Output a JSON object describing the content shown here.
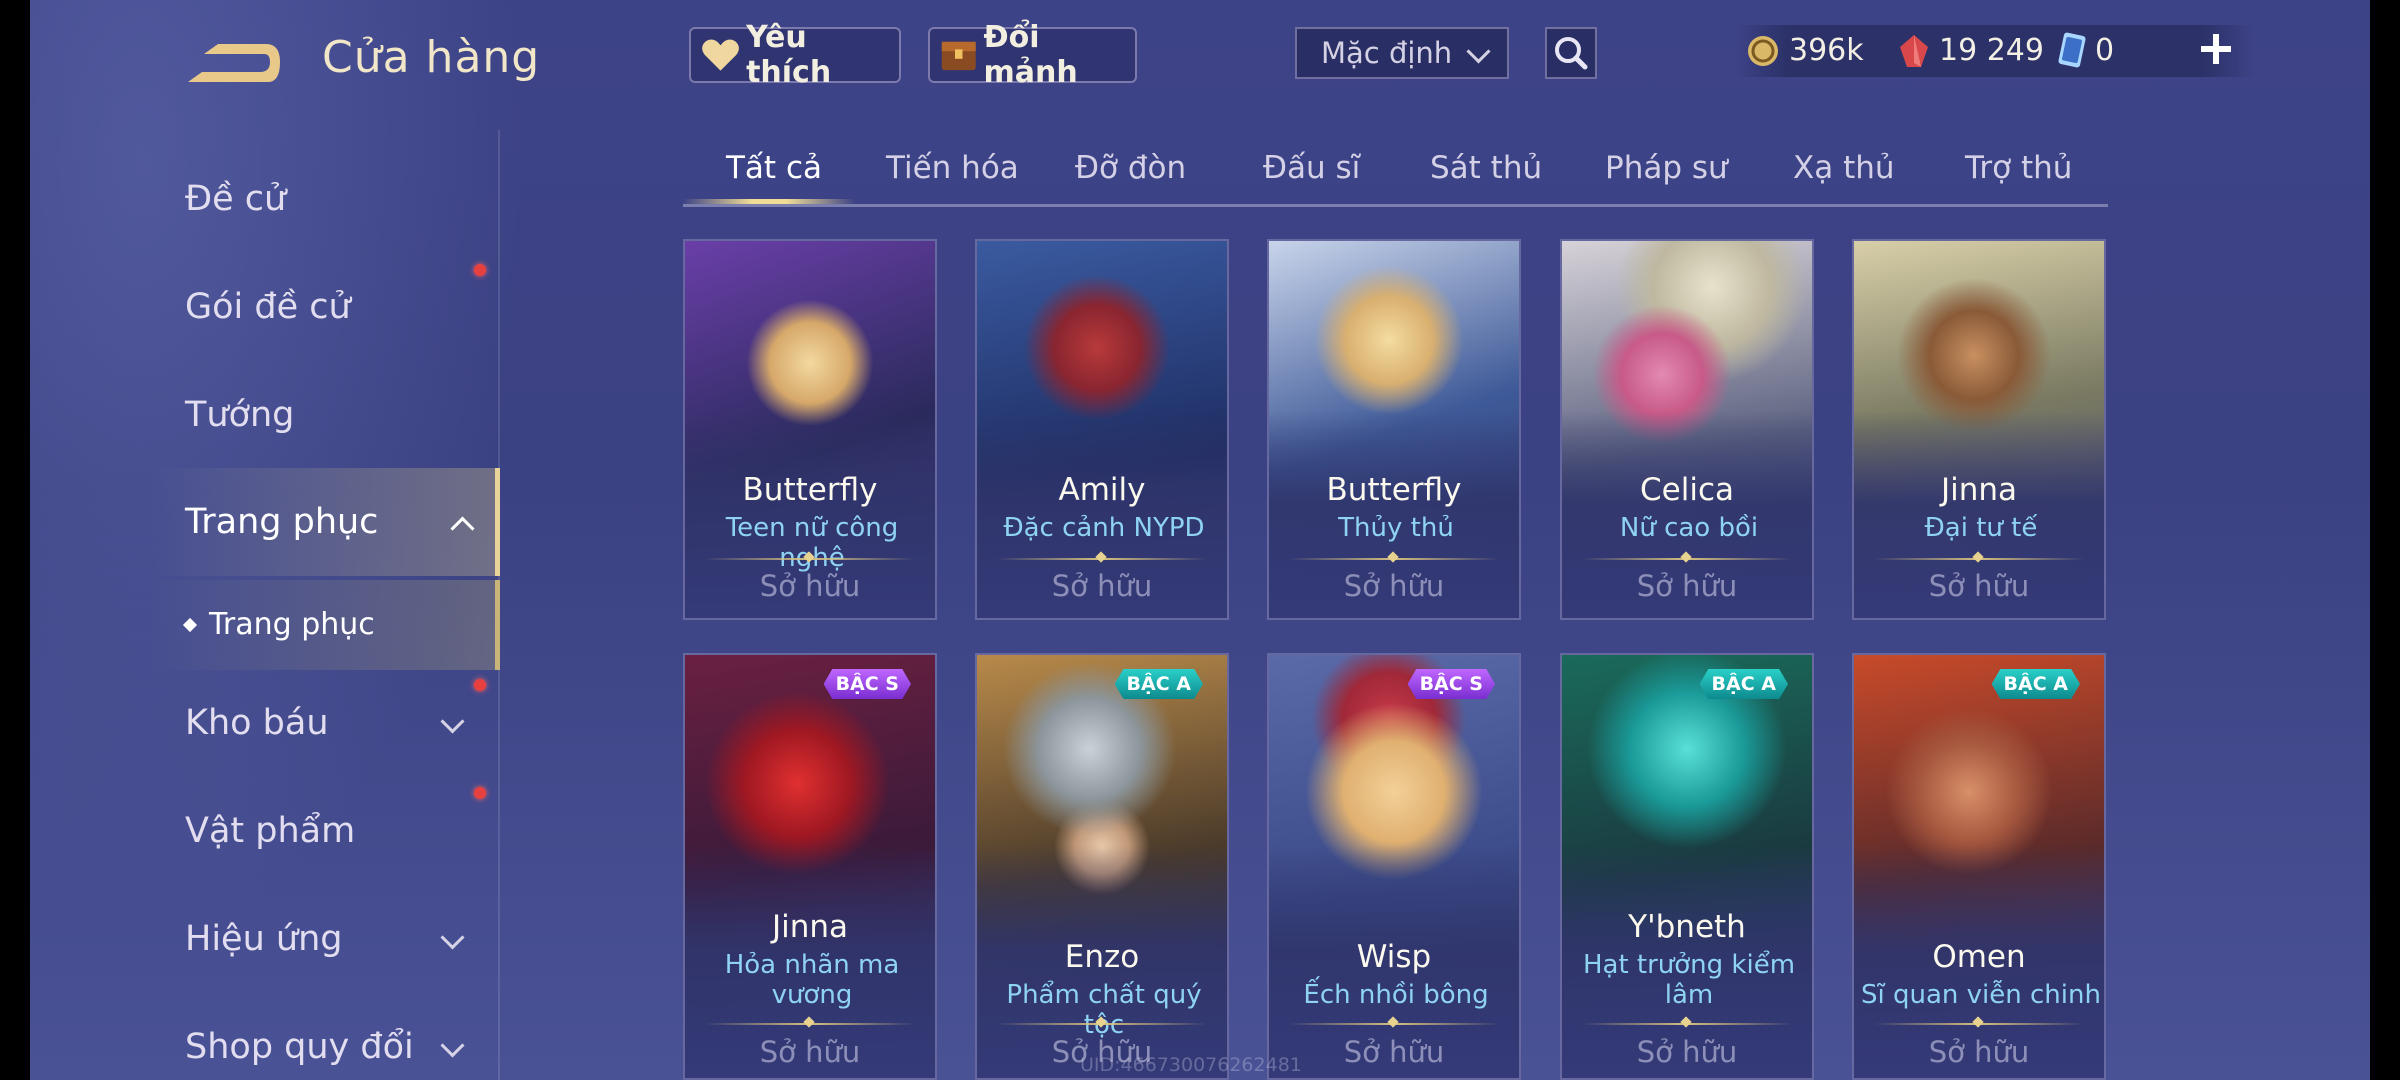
{
  "header": {
    "title": "Cửa hàng"
  },
  "sidebar": {
    "items": [
      {
        "label": "Đề cử"
      },
      {
        "label": "Gói đề cử"
      },
      {
        "label": "Tướng"
      },
      {
        "label": "Trang phục"
      },
      {
        "label": "Trang phục"
      },
      {
        "label": "Kho báu"
      },
      {
        "label": "Vật phẩm"
      },
      {
        "label": "Hiệu ứng"
      },
      {
        "label": "Shop quy đổi"
      }
    ]
  },
  "topbar": {
    "favorite_label": "Yêu thích",
    "exchange_label": "Đổi mảnh",
    "sort_value": "Mặc định",
    "gold": "396k",
    "vouchers": "19 249",
    "tickets": "0"
  },
  "tabs": [
    "Tất cả",
    "Tiến hóa",
    "Đỡ đòn",
    "Đấu sĩ",
    "Sát thủ",
    "Pháp sư",
    "Xạ thủ",
    "Trợ thủ"
  ],
  "cards": [
    {
      "hero": "Butterfly",
      "skin": "Teen nữ công nghệ",
      "status": "Sở hữu",
      "badge": ""
    },
    {
      "hero": "Amily",
      "skin": "Đặc cảnh NYPD",
      "status": "Sở hữu",
      "badge": ""
    },
    {
      "hero": "Butterfly",
      "skin": "Thủy thủ",
      "status": "Sở hữu",
      "badge": ""
    },
    {
      "hero": "Celica",
      "skin": "Nữ cao bồi",
      "status": "Sở hữu",
      "badge": ""
    },
    {
      "hero": "Jinna",
      "skin": "Đại tư tế",
      "status": "Sở hữu",
      "badge": ""
    },
    {
      "hero": "Jinna",
      "skin": "Hỏa nhãn ma vương",
      "status": "Sở hữu",
      "badge": "BẬC S"
    },
    {
      "hero": "Enzo",
      "skin": "Phẩm chất quý tộc",
      "status": "Sở hữu",
      "badge": "BẬC A"
    },
    {
      "hero": "Wisp",
      "skin": "Ếch nhồi bông",
      "status": "Sở hữu",
      "badge": "BẬC S"
    },
    {
      "hero": "Y'bneth",
      "skin": "Hạt trưởng kiểm lâm",
      "status": "Sở hữu",
      "badge": "BẬC A"
    },
    {
      "hero": "Omen",
      "skin": "Sĩ quan viễn chinh",
      "status": "Sở hữu",
      "badge": "BẬC A"
    }
  ],
  "uid_text": "UID:466730076262481",
  "colors": {
    "accent_gold": "#f0dc96",
    "skin_text": "#8fd3f2",
    "notify_red": "#e8403e"
  }
}
